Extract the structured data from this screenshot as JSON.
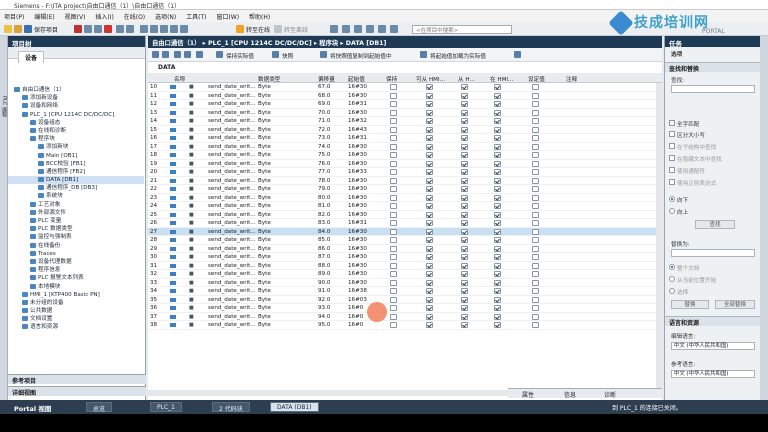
{
  "window": {
    "title": "Siemens - F:\\ITA project\\自由口通信（1）\\自由口通信（1）"
  },
  "menu": [
    "项目(P)",
    "编辑(E)",
    "视图(V)",
    "插入(I)",
    "在线(O)",
    "选项(N)",
    "工具(T)",
    "窗口(W)",
    "帮助(H)"
  ],
  "toolbar": {
    "save_project": "保存项目",
    "go_online": "转至在线",
    "go_offline": "转至离线",
    "search_placeholder": "<在项目中搜索>"
  },
  "logo": {
    "text": "技成培训网",
    "sub": "PORTAL"
  },
  "project_panel": {
    "title": "项目树",
    "tab": "设备",
    "tree": [
      {
        "label": "自由口通信（1）",
        "indent": 0
      },
      {
        "label": "添加新设备",
        "indent": 1
      },
      {
        "label": "设备和网络",
        "indent": 1
      },
      {
        "label": "PLC_1 [CPU 1214C DC/DC/DC]",
        "indent": 1
      },
      {
        "label": "设备组态",
        "indent": 2
      },
      {
        "label": "在线和诊断",
        "indent": 2
      },
      {
        "label": "程序块",
        "indent": 2
      },
      {
        "label": "添加新块",
        "indent": 3
      },
      {
        "label": "Main [OB1]",
        "indent": 3
      },
      {
        "label": "BCC校验 [FB1]",
        "indent": 3
      },
      {
        "label": "通信程序 [FB2]",
        "indent": 3
      },
      {
        "label": "DATA [DB1]",
        "indent": 3,
        "selected": true
      },
      {
        "label": "通信程序_DB [DB3]",
        "indent": 3
      },
      {
        "label": "系统块",
        "indent": 3
      },
      {
        "label": "工艺对象",
        "indent": 2
      },
      {
        "label": "外部源文件",
        "indent": 2
      },
      {
        "label": "PLC 变量",
        "indent": 2
      },
      {
        "label": "PLC 数据类型",
        "indent": 2
      },
      {
        "label": "监控与强制表",
        "indent": 2
      },
      {
        "label": "在线备份",
        "indent": 2
      },
      {
        "label": "Traces",
        "indent": 2
      },
      {
        "label": "设备代理数据",
        "indent": 2
      },
      {
        "label": "程序信息",
        "indent": 2
      },
      {
        "label": "PLC 报警文本列表",
        "indent": 2
      },
      {
        "label": "本地模块",
        "indent": 2
      },
      {
        "label": "HMI_1 [KTP400 Basic PN]",
        "indent": 1
      },
      {
        "label": "未分组的设备",
        "indent": 1
      },
      {
        "label": "公共数据",
        "indent": 1
      },
      {
        "label": "文档设置",
        "indent": 1
      },
      {
        "label": "语言和资源",
        "indent": 1
      }
    ],
    "ref_project": "参考项目",
    "detail_view": "详细视图"
  },
  "editor": {
    "breadcrumb": "自由口通信（1） ▸ PLC_1 [CPU 1214C DC/DC/DC] ▸ 程序块 ▸ DATA [DB1]",
    "toolbar": {
      "keep_actual": "保持实际值",
      "snapshot": "快照",
      "copy_snapshot": "将快照值复制到起始值中",
      "load_start": "将起始值加载为实际值"
    },
    "db_name": "DATA",
    "columns": [
      "名称",
      "数据类型",
      "偏移量",
      "起始值",
      "保持",
      "可从 HMI...",
      "从 H...",
      "在 HMI...",
      "设定值",
      "注释"
    ],
    "rows": [
      {
        "no": "10",
        "name": "send_date_writ...",
        "type": "Byte",
        "offset": "67.0",
        "start": "16#30"
      },
      {
        "no": "11",
        "name": "send_date_writ...",
        "type": "Byte",
        "offset": "68.0",
        "start": "16#30"
      },
      {
        "no": "12",
        "name": "send_date_writ...",
        "type": "Byte",
        "offset": "69.0",
        "start": "16#31"
      },
      {
        "no": "13",
        "name": "send_date_writ...",
        "type": "Byte",
        "offset": "70.0",
        "start": "16#30"
      },
      {
        "no": "14",
        "name": "send_date_writ...",
        "type": "Byte",
        "offset": "71.0",
        "start": "16#32"
      },
      {
        "no": "15",
        "name": "send_date_writ...",
        "type": "Byte",
        "offset": "72.0",
        "start": "16#43"
      },
      {
        "no": "16",
        "name": "send_date_writ...",
        "type": "Byte",
        "offset": "73.0",
        "start": "16#31"
      },
      {
        "no": "17",
        "name": "send_date_writ...",
        "type": "Byte",
        "offset": "74.0",
        "start": "16#30"
      },
      {
        "no": "18",
        "name": "send_date_writ...",
        "type": "Byte",
        "offset": "75.0",
        "start": "16#30"
      },
      {
        "no": "19",
        "name": "send_date_writ...",
        "type": "Byte",
        "offset": "76.0",
        "start": "16#30"
      },
      {
        "no": "20",
        "name": "send_date_writ...",
        "type": "Byte",
        "offset": "77.0",
        "start": "16#33"
      },
      {
        "no": "21",
        "name": "send_date_writ...",
        "type": "Byte",
        "offset": "78.0",
        "start": "16#30"
      },
      {
        "no": "22",
        "name": "send_date_writ...",
        "type": "Byte",
        "offset": "79.0",
        "start": "16#30"
      },
      {
        "no": "23",
        "name": "send_date_writ...",
        "type": "Byte",
        "offset": "80.0",
        "start": "16#30"
      },
      {
        "no": "24",
        "name": "send_date_writ...",
        "type": "Byte",
        "offset": "81.0",
        "start": "16#30"
      },
      {
        "no": "25",
        "name": "send_date_writ...",
        "type": "Byte",
        "offset": "82.0",
        "start": "16#30"
      },
      {
        "no": "26",
        "name": "send_date_writ...",
        "type": "Byte",
        "offset": "83.0",
        "start": "16#31"
      },
      {
        "no": "27",
        "name": "send_date_writ...",
        "type": "Byte",
        "offset": "84.0",
        "start": "16#30",
        "selected": true
      },
      {
        "no": "28",
        "name": "send_date_writ...",
        "type": "Byte",
        "offset": "85.0",
        "start": "16#30"
      },
      {
        "no": "29",
        "name": "send_date_writ...",
        "type": "Byte",
        "offset": "86.0",
        "start": "16#30"
      },
      {
        "no": "30",
        "name": "send_date_writ...",
        "type": "Byte",
        "offset": "87.0",
        "start": "16#30"
      },
      {
        "no": "31",
        "name": "send_date_writ...",
        "type": "Byte",
        "offset": "88.0",
        "start": "16#30"
      },
      {
        "no": "32",
        "name": "send_date_writ...",
        "type": "Byte",
        "offset": "89.0",
        "start": "16#30"
      },
      {
        "no": "33",
        "name": "send_date_writ...",
        "type": "Byte",
        "offset": "90.0",
        "start": "16#30"
      },
      {
        "no": "34",
        "name": "send_date_writ...",
        "type": "Byte",
        "offset": "91.0",
        "start": "16#38"
      },
      {
        "no": "35",
        "name": "send_date_writ...",
        "type": "Byte",
        "offset": "92.0",
        "start": "16#03"
      },
      {
        "no": "36",
        "name": "send_date_writ...",
        "type": "Byte",
        "offset": "93.0",
        "start": "16#0"
      },
      {
        "no": "37",
        "name": "send_date_writ...",
        "type": "Byte",
        "offset": "94.0",
        "start": "16#0"
      },
      {
        "no": "38",
        "name": "send_date_writ...",
        "type": "Byte",
        "offset": "95.0",
        "start": "16#0"
      }
    ]
  },
  "task_panel": {
    "title": "任务",
    "options": "选项",
    "find_replace": "查找和替换",
    "find_label": "查找:",
    "whole_word": "全字匹配",
    "match_case": "区分大小写",
    "search_sub": "在子结构中查找",
    "search_hidden": "在隐藏文本中查找",
    "use_wildcards": "使用通配符",
    "use_regex": "使用正则表达式",
    "down": "向下",
    "up": "向上",
    "find_btn": "查找",
    "replace_label": "替换为:",
    "whole_doc": "整个文档",
    "from_current": "从当前位置开始",
    "selection": "选择",
    "replace_btn": "替换",
    "replace_all_btn": "全部替换",
    "lang_res": "语言和资源",
    "edit_lang_label": "编辑语言:",
    "edit_lang": "中文 (中华人民共和国)",
    "ref_lang_label": "参考语言:",
    "ref_lang": "中文 (中华人民共和国)"
  },
  "info_bar": {
    "properties": "属性",
    "info": "信息",
    "diagnostics": "诊断"
  },
  "statusbar": {
    "portal_view": "Portal 视图",
    "tabs": [
      "总览",
      "PLC_1",
      "2 代码块",
      "DATA (DB1)"
    ],
    "message": "到 PLC_1 的连接已关闭。"
  }
}
